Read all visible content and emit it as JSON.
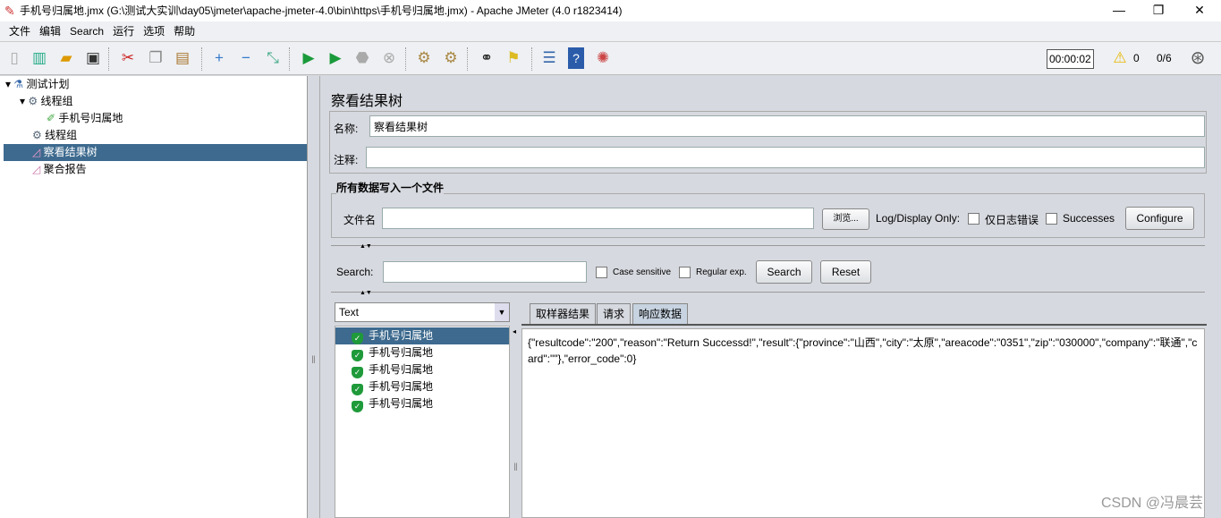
{
  "window": {
    "title": "手机号归属地.jmx (G:\\测试大实训\\day05\\jmeter\\apache-jmeter-4.0\\bin\\https\\手机号归属地.jmx) - Apache JMeter (4.0 r1823414)",
    "minimize": "—",
    "maximize": "❐",
    "close": "✕"
  },
  "menu": [
    "文件",
    "编辑",
    "Search",
    "运行",
    "选项",
    "帮助"
  ],
  "toolbar": {
    "timer": "00:00:02",
    "warnings": "0",
    "threads": "0/6"
  },
  "tree": [
    {
      "label": "测试计划",
      "icon": "flask-icon"
    },
    {
      "label": "线程组",
      "icon": "gear-icon"
    },
    {
      "label": "手机号归属地",
      "icon": "pipette-icon"
    },
    {
      "label": "线程组",
      "icon": "gear-icon"
    },
    {
      "label": "察看结果树",
      "icon": "chart-icon"
    },
    {
      "label": "聚合报告",
      "icon": "chart-icon"
    }
  ],
  "panel": {
    "title": "察看结果树",
    "name_label": "名称:",
    "name_value": "察看结果树",
    "comment_label": "注释:",
    "comment_value": "",
    "file_section": "所有数据写入一个文件",
    "file_label": "文件名",
    "file_value": "",
    "browse": "浏览...",
    "log_display": "Log/Display Only:",
    "errors_only": "仅日志错误",
    "successes": "Successes",
    "configure": "Configure"
  },
  "search": {
    "label": "Search:",
    "value": "",
    "case_sensitive": "Case sensitive",
    "regex": "Regular exp.",
    "search_btn": "Search",
    "reset_btn": "Reset"
  },
  "renderer": "Text",
  "results": [
    "手机号归属地",
    "手机号归属地",
    "手机号归属地",
    "手机号归属地",
    "手机号归属地"
  ],
  "tabs": [
    "取样器结果",
    "请求",
    "响应数据"
  ],
  "response": "{\"resultcode\":\"200\",\"reason\":\"Return Successd!\",\"result\":{\"province\":\"山西\",\"city\":\"太原\",\"areacode\":\"0351\",\"zip\":\"030000\",\"company\":\"联通\",\"card\":\"\"},\"error_code\":0}",
  "watermark": "CSDN @冯晨芸"
}
